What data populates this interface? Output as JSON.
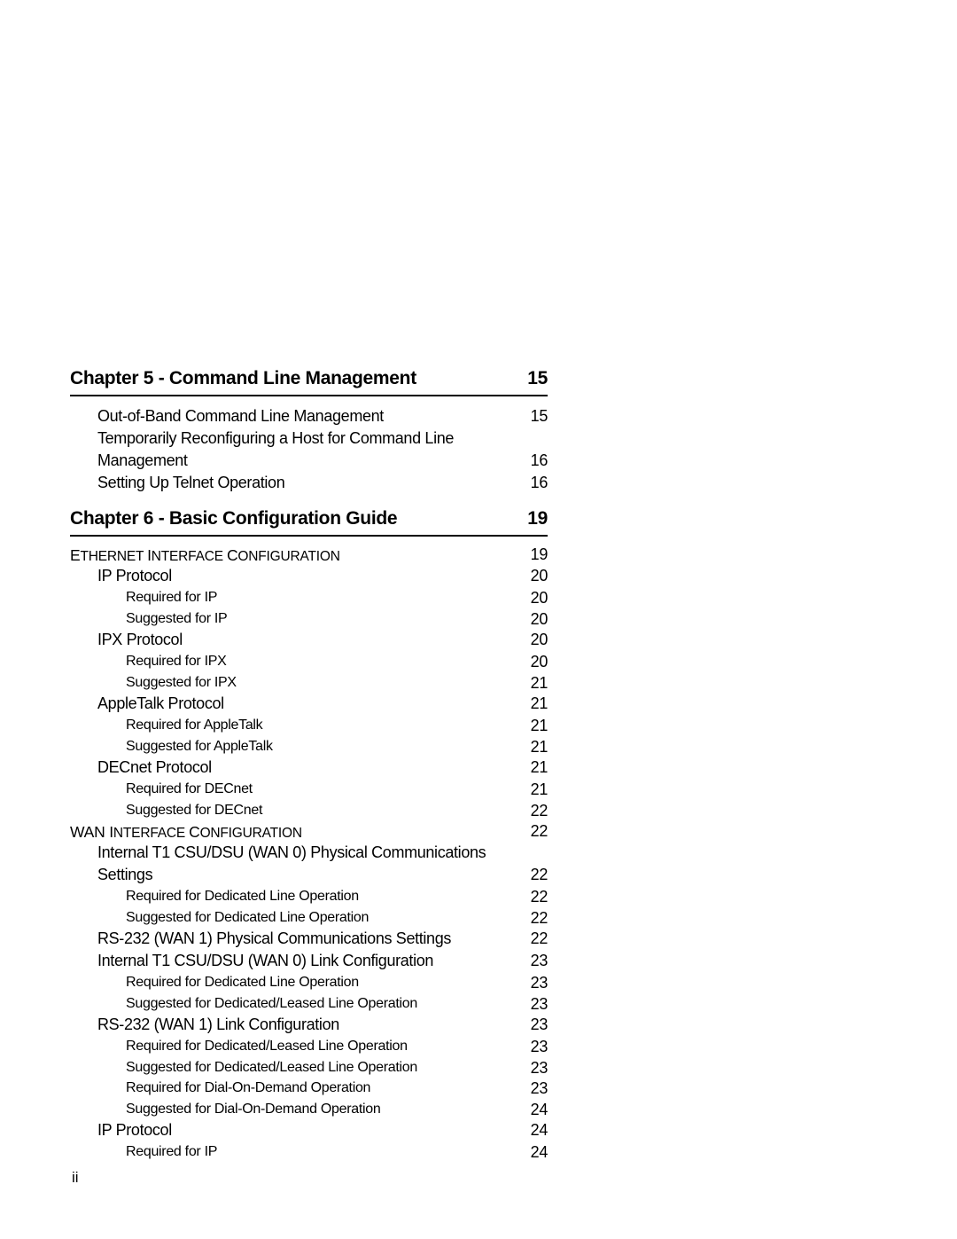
{
  "toc": {
    "chapter5": {
      "title": "Chapter 5 - Command Line Management",
      "page": "15",
      "entries": [
        {
          "title": "Out-of-Band Command Line Management",
          "page": "15"
        },
        {
          "title_line1": "Temporarily Reconfiguring a Host for Command Line",
          "title_line2": "Management",
          "page": "16"
        },
        {
          "title": "Setting Up Telnet Operation",
          "page": "16"
        }
      ]
    },
    "chapter6": {
      "title": "Chapter 6 - Basic Configuration Guide",
      "page": "19",
      "ethernet": {
        "title_parts": [
          "E",
          "THERNET ",
          "I",
          "NTERFACE ",
          "C",
          "ONFIGURATION"
        ],
        "page": "19",
        "entries": [
          {
            "title": "IP Protocol",
            "page": "20",
            "level": 1
          },
          {
            "title": "Required for IP",
            "page": "20",
            "level": 2
          },
          {
            "title": "Suggested for IP",
            "page": "20",
            "level": 2
          },
          {
            "title": "IPX Protocol",
            "page": "20",
            "level": 1
          },
          {
            "title": "Required for IPX",
            "page": "20",
            "level": 2
          },
          {
            "title": "Suggested for IPX",
            "page": "21",
            "level": 2
          },
          {
            "title": "AppleTalk Protocol",
            "page": "21",
            "level": 1
          },
          {
            "title": "Required for AppleTalk",
            "page": "21",
            "level": 2
          },
          {
            "title": "Suggested for AppleTalk",
            "page": "21",
            "level": 2
          },
          {
            "title": "DECnet Protocol",
            "page": "21",
            "level": 1
          },
          {
            "title": "Required for DECnet",
            "page": "21",
            "level": 2
          },
          {
            "title": "Suggested for DECnet",
            "page": "22",
            "level": 2
          }
        ]
      },
      "wan": {
        "title_parts": [
          "WAN ",
          "I",
          "NTERFACE ",
          "C",
          "ONFIGURATION"
        ],
        "page": "22",
        "t1_physical": {
          "title_line1": "Internal T1 CSU/DSU (WAN 0) Physical Communications",
          "title_line2": "Settings",
          "page": "22"
        },
        "entries": [
          {
            "title": "Required for Dedicated Line Operation",
            "page": "22",
            "level": 2
          },
          {
            "title": "Suggested for Dedicated Line Operation",
            "page": "22",
            "level": 2
          },
          {
            "title": "RS-232 (WAN 1) Physical Communications Settings",
            "page": "22",
            "level": 1
          },
          {
            "title": "Internal T1 CSU/DSU (WAN 0) Link Configuration",
            "page": "23",
            "level": 1
          },
          {
            "title": "Required for Dedicated Line Operation",
            "page": "23",
            "level": 2
          },
          {
            "title": "Suggested for Dedicated/Leased Line Operation",
            "page": "23",
            "level": 2
          },
          {
            "title": "RS-232 (WAN 1) Link Configuration",
            "page": "23",
            "level": 1
          },
          {
            "title": "Required for Dedicated/Leased Line Operation",
            "page": "23",
            "level": 2
          },
          {
            "title": "Suggested for Dedicated/Leased Line Operation",
            "page": "23",
            "level": 2
          },
          {
            "title": "Required for Dial-On-Demand Operation",
            "page": "23",
            "level": 2
          },
          {
            "title": "Suggested for Dial-On-Demand Operation",
            "page": "24",
            "level": 2
          },
          {
            "title": "IP Protocol",
            "page": "24",
            "level": 1
          },
          {
            "title": "Required for IP",
            "page": "24",
            "level": 2
          }
        ]
      }
    }
  },
  "footer": {
    "page_number": "ii"
  }
}
